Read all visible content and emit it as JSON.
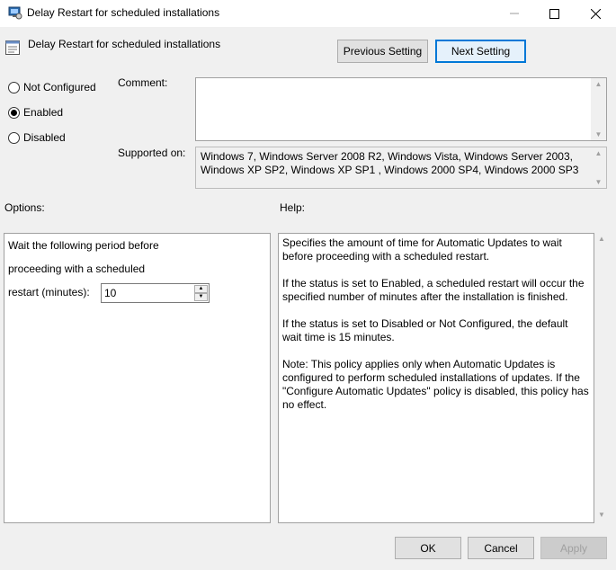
{
  "window": {
    "title": "Delay Restart for scheduled installations",
    "controls": {
      "minimize": "─",
      "maximize": "☐",
      "close": "✕"
    }
  },
  "header": {
    "policy_title": "Delay Restart for scheduled installations",
    "previous_label": "Previous Setting",
    "next_label": "Next Setting"
  },
  "state": {
    "options": [
      "Not Configured",
      "Enabled",
      "Disabled"
    ],
    "selected": "Enabled"
  },
  "comment": {
    "label": "Comment:",
    "value": ""
  },
  "supported": {
    "label": "Supported on:",
    "value": "Windows 7, Windows Server 2008 R2, Windows Vista, Windows Server 2003, Windows XP SP2, Windows XP SP1 , Windows 2000 SP4, Windows 2000 SP3"
  },
  "options_panel": {
    "label": "Options:",
    "line1": "Wait the following period before",
    "line2": "proceeding with a scheduled",
    "line3": "restart (minutes):",
    "restart_minutes": "10"
  },
  "help_panel": {
    "label": "Help:",
    "paragraphs": [
      "Specifies the amount of time for Automatic Updates to wait before proceeding with a scheduled restart.",
      "If the status is set to Enabled, a scheduled restart will occur the specified number of minutes after the installation is finished.",
      "If the status is set to Disabled or Not Configured, the default wait time is 15 minutes.",
      "Note: This policy applies only when Automatic Updates is configured to perform scheduled installations of updates. If the \"Configure Automatic Updates\" policy is disabled, this policy has no effect."
    ]
  },
  "footer": {
    "ok": "OK",
    "cancel": "Cancel",
    "apply": "Apply"
  },
  "colors": {
    "focus_border": "#0078d7",
    "window_bg": "#f0f0f0"
  }
}
